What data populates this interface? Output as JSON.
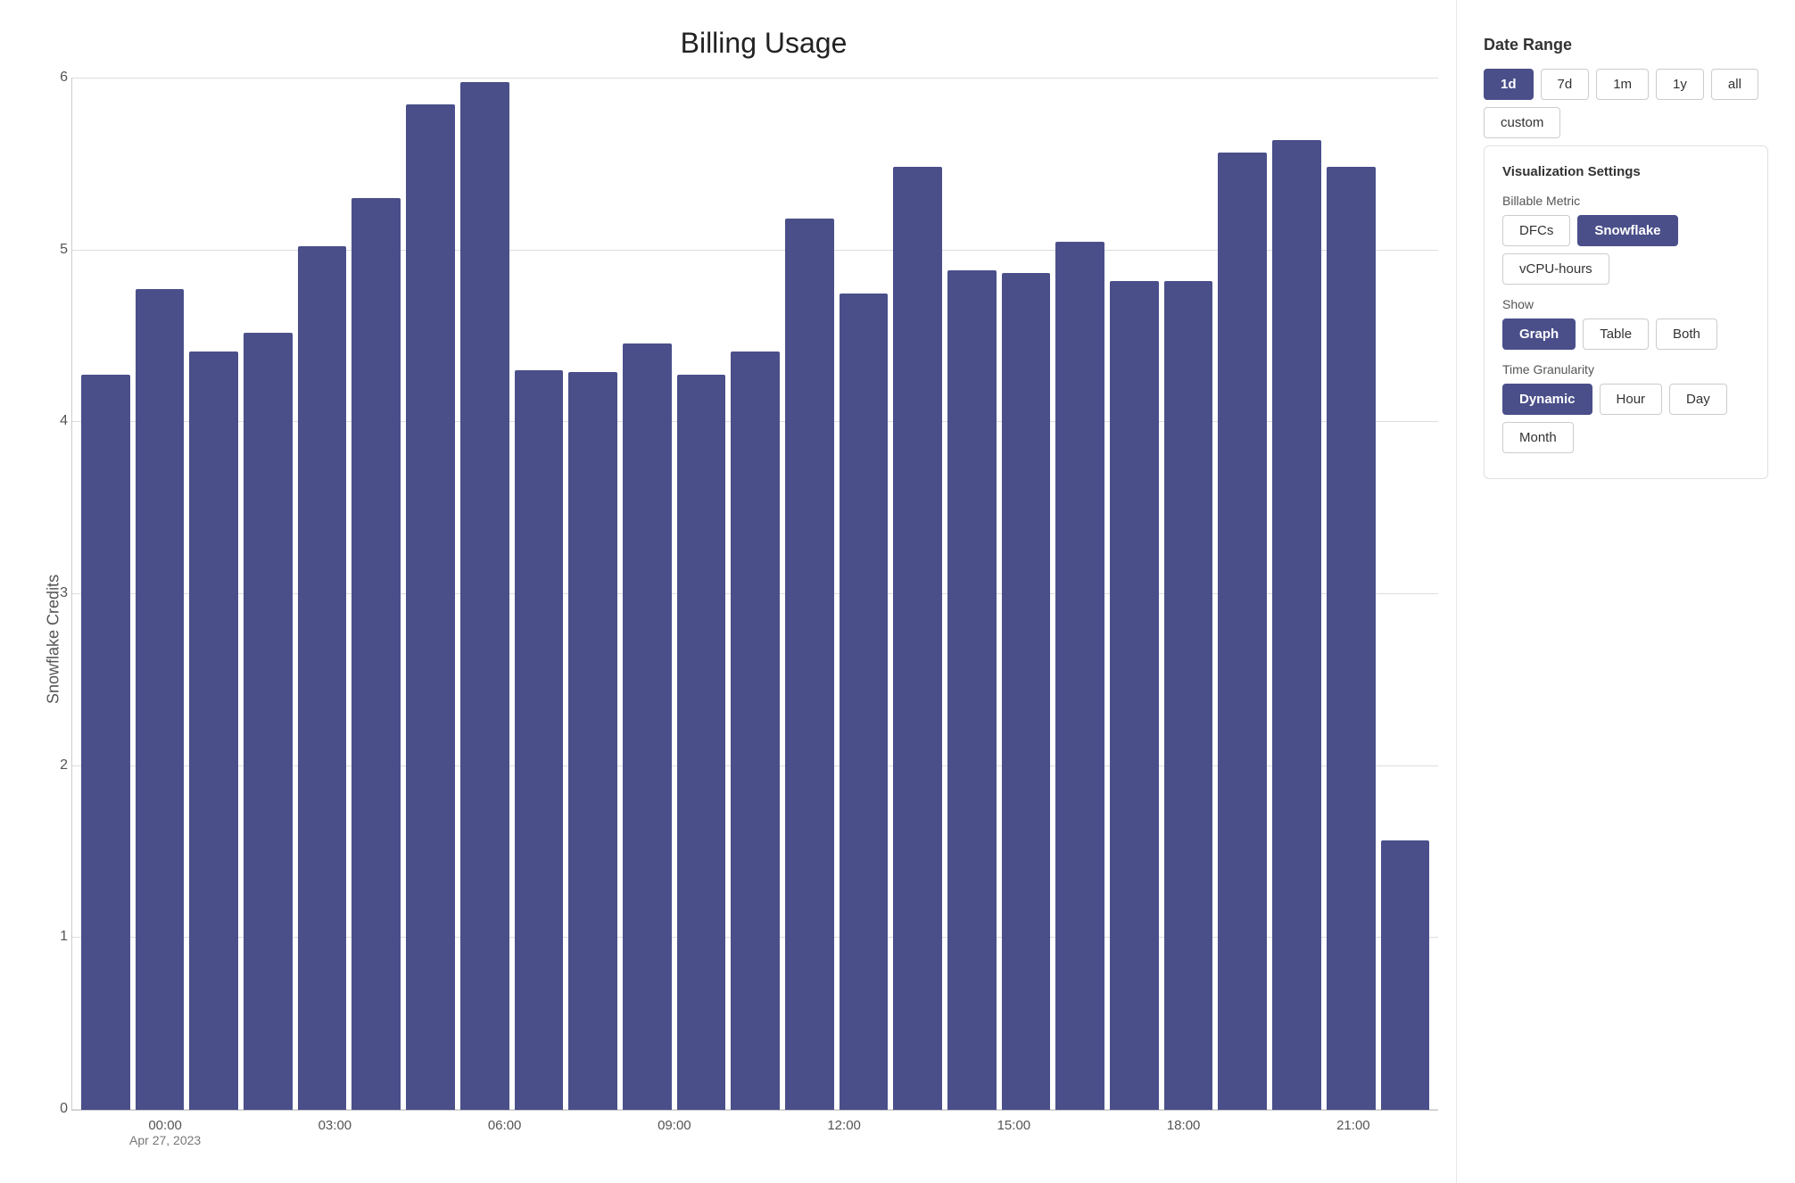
{
  "page": {
    "title": "Billing Usage"
  },
  "chart": {
    "y_axis_label": "Snowflake Credits",
    "y_axis_labels": [
      "0",
      "1",
      "2",
      "3",
      "4",
      "5",
      "6"
    ],
    "x_labels": [
      {
        "time": "00:00",
        "date": "Apr 27, 2023"
      },
      {
        "time": "03:00",
        "date": ""
      },
      {
        "time": "06:00",
        "date": ""
      },
      {
        "time": "09:00",
        "date": ""
      },
      {
        "time": "12:00",
        "date": ""
      },
      {
        "time": "15:00",
        "date": ""
      },
      {
        "time": "18:00",
        "date": ""
      },
      {
        "time": "21:00",
        "date": ""
      }
    ],
    "bars": [
      {
        "value": 4.7,
        "max": 6.6
      },
      {
        "value": 5.25,
        "max": 6.6
      },
      {
        "value": 4.85,
        "max": 6.6
      },
      {
        "value": 4.97,
        "max": 6.6
      },
      {
        "value": 5.52,
        "max": 6.6
      },
      {
        "value": 5.83,
        "max": 6.6
      },
      {
        "value": 6.43,
        "max": 6.6
      },
      {
        "value": 6.57,
        "max": 6.6
      },
      {
        "value": 4.73,
        "max": 6.6
      },
      {
        "value": 4.72,
        "max": 6.6
      },
      {
        "value": 4.9,
        "max": 6.6
      },
      {
        "value": 4.7,
        "max": 6.6
      },
      {
        "value": 4.85,
        "max": 6.6
      },
      {
        "value": 5.7,
        "max": 6.6
      },
      {
        "value": 5.22,
        "max": 6.6
      },
      {
        "value": 6.03,
        "max": 6.6
      },
      {
        "value": 5.37,
        "max": 6.6
      },
      {
        "value": 5.35,
        "max": 6.6
      },
      {
        "value": 5.55,
        "max": 6.6
      },
      {
        "value": 5.3,
        "max": 6.6
      },
      {
        "value": 5.3,
        "max": 6.6
      },
      {
        "value": 6.12,
        "max": 6.6
      },
      {
        "value": 6.2,
        "max": 6.6
      },
      {
        "value": 6.03,
        "max": 6.6
      },
      {
        "value": 1.72,
        "max": 6.6
      }
    ]
  },
  "sidebar": {
    "date_range": {
      "label": "Date Range",
      "options": [
        "1d",
        "7d",
        "1m",
        "1y",
        "all",
        "custom"
      ],
      "active": "1d"
    },
    "visualization": {
      "title": "Visualization Settings",
      "billable_metric": {
        "label": "Billable Metric",
        "options": [
          "DFCs",
          "Snowflake",
          "vCPU-hours"
        ],
        "active": "Snowflake"
      },
      "show": {
        "label": "Show",
        "options": [
          "Graph",
          "Table",
          "Both"
        ],
        "active": "Graph"
      },
      "time_granularity": {
        "label": "Time Granularity",
        "options": [
          "Dynamic",
          "Hour",
          "Day",
          "Month"
        ],
        "active": "Dynamic"
      }
    }
  }
}
